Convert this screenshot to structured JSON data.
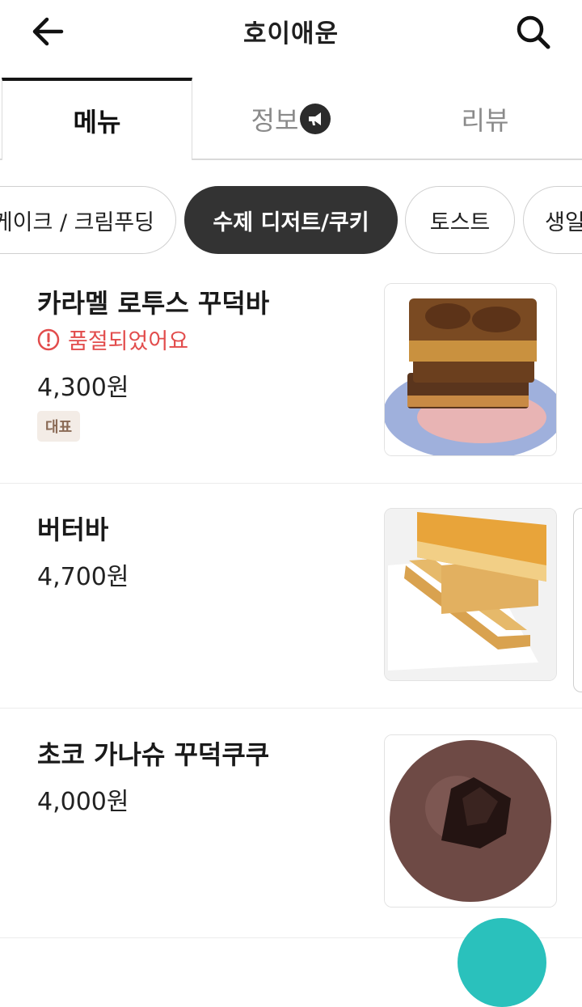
{
  "header": {
    "title": "호이애운",
    "back_icon": "arrow-left-icon",
    "search_icon": "search-icon"
  },
  "tabs": [
    {
      "label": "메뉴",
      "active": true
    },
    {
      "label": "정보",
      "icon": "megaphone-icon"
    },
    {
      "label": "리뷰"
    }
  ],
  "categories": [
    {
      "label": "케이크 / 크림푸딩"
    },
    {
      "label": "수제 디저트/쿠키",
      "active": true
    },
    {
      "label": "토스트"
    },
    {
      "label": "생일"
    }
  ],
  "menu": [
    {
      "name": "카라멜 로투스 꾸덕바",
      "sold_out": "품절되었어요",
      "price": "4,300원",
      "tag": "대표"
    },
    {
      "name": "버터바",
      "price": "4,700원"
    },
    {
      "name": "초코 가나슈 꾸덕쿠쿠",
      "price": "4,000원"
    }
  ],
  "colors": {
    "accent": "#2ac1bc",
    "sold_out": "#e24c4c",
    "active_chip": "#333333"
  }
}
